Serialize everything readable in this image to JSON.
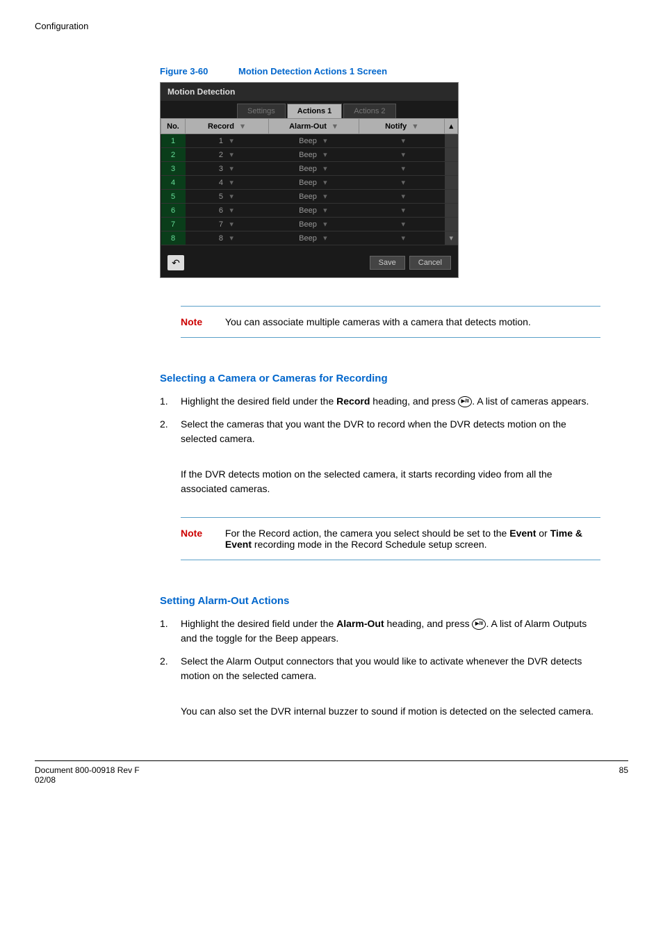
{
  "header": "Configuration",
  "figure": {
    "label": "Figure 3-60",
    "title": "Motion Detection Actions 1 Screen"
  },
  "screenshot": {
    "window_title": "Motion Detection",
    "tabs": {
      "settings": "Settings",
      "actions1": "Actions 1",
      "actions2": "Actions 2"
    },
    "columns": {
      "no": "No.",
      "record": "Record",
      "alarm_out": "Alarm-Out",
      "notify": "Notify"
    },
    "rows": [
      {
        "no": "1",
        "record": "1",
        "alarm_out": "Beep",
        "notify": ""
      },
      {
        "no": "2",
        "record": "2",
        "alarm_out": "Beep",
        "notify": ""
      },
      {
        "no": "3",
        "record": "3",
        "alarm_out": "Beep",
        "notify": ""
      },
      {
        "no": "4",
        "record": "4",
        "alarm_out": "Beep",
        "notify": ""
      },
      {
        "no": "5",
        "record": "5",
        "alarm_out": "Beep",
        "notify": ""
      },
      {
        "no": "6",
        "record": "6",
        "alarm_out": "Beep",
        "notify": ""
      },
      {
        "no": "7",
        "record": "7",
        "alarm_out": "Beep",
        "notify": ""
      },
      {
        "no": "8",
        "record": "8",
        "alarm_out": "Beep",
        "notify": ""
      }
    ],
    "buttons": {
      "save": "Save",
      "cancel": "Cancel"
    }
  },
  "note1": {
    "label": "Note",
    "text": "You can associate multiple cameras with a camera that detects motion."
  },
  "section1": {
    "heading": "Selecting a Camera or Cameras for Recording",
    "step1_a": "Highlight the desired field under the ",
    "step1_b": "Record",
    "step1_c": " heading, and press ",
    "step1_d": ". A list of cameras appears.",
    "step2": "Select the cameras that you want the DVR to record when the DVR detects motion on the selected camera.",
    "continuation": "If the DVR detects motion on the selected camera, it starts recording video from all the associated cameras."
  },
  "note2": {
    "label": "Note",
    "text_a": "For the Record action, the camera you select should be set to the ",
    "text_b": "Event",
    "text_c": " or ",
    "text_d": "Time & Event",
    "text_e": " recording mode in the Record Schedule setup screen."
  },
  "section2": {
    "heading": "Setting Alarm-Out Actions",
    "step1_a": "Highlight the desired field under the ",
    "step1_b": "Alarm-Out",
    "step1_c": " heading, and press ",
    "step1_d": ". A list of Alarm Outputs and the toggle for the Beep appears.",
    "step2": "Select the Alarm Output connectors that you would like to activate whenever the DVR detects motion on the selected camera.",
    "continuation": "You can also set the DVR internal buzzer to sound if motion is detected on the selected camera."
  },
  "footer": {
    "doc": "Document 800-00918 Rev F",
    "date": "02/08",
    "page": "85"
  }
}
